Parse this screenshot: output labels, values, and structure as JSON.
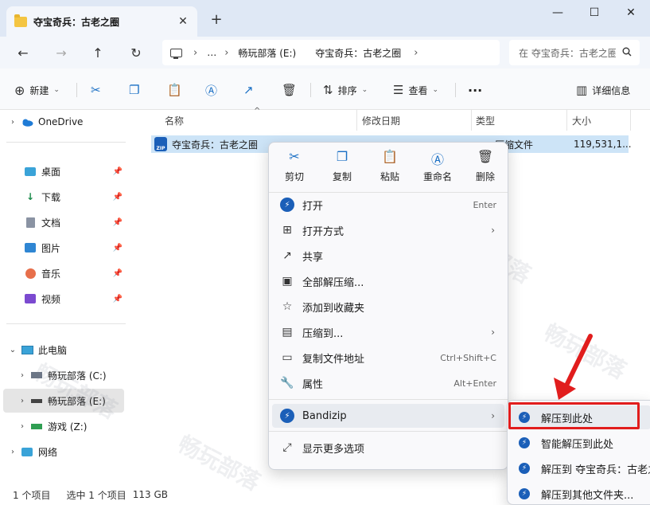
{
  "window": {
    "tab_title": "夺宝奇兵：古老之圈",
    "tab_close": "✕",
    "new_tab": "+",
    "minimize": "—",
    "maximize": "☐",
    "close": "✕"
  },
  "nav": {
    "back": "←",
    "forward": "→",
    "up": "↑",
    "refresh": "↻"
  },
  "address": {
    "crumbs": [
      "…",
      "畅玩部落 (E:)",
      "夺宝奇兵：古老之圈"
    ],
    "separator": "›",
    "search_placeholder": "在 夺宝奇兵：古老之圈 中搜索"
  },
  "commandbar": {
    "new_label": "新建",
    "sort_label": "排序",
    "view_label": "查看",
    "more_label": "···",
    "details_label": "详细信息"
  },
  "sidebar": {
    "onedrive": "OneDrive",
    "quick": [
      {
        "label": "桌面",
        "icon": "desktop-icon"
      },
      {
        "label": "下载",
        "icon": "download-icon"
      },
      {
        "label": "文档",
        "icon": "document-icon"
      },
      {
        "label": "图片",
        "icon": "picture-icon"
      },
      {
        "label": "音乐",
        "icon": "music-icon"
      },
      {
        "label": "视频",
        "icon": "video-icon"
      }
    ],
    "this_pc": "此电脑",
    "drives": [
      {
        "label": "畅玩部落 (C:)"
      },
      {
        "label": "畅玩部落 (E:)"
      },
      {
        "label": "游戏 (Z:)"
      }
    ],
    "network": "网络"
  },
  "filelist": {
    "columns": [
      "名称",
      "修改日期",
      "类型",
      "大小"
    ],
    "sort_indicator": "^",
    "rows": [
      {
        "name": "夺宝奇兵：古老之圈",
        "type": "压缩文件",
        "size": "119,531,1..."
      }
    ]
  },
  "status": {
    "count": "1 个项目",
    "selected": "选中 1 个项目",
    "size": "113 GB"
  },
  "context_menu": {
    "quick": [
      {
        "label": "剪切",
        "icon": "cut-icon"
      },
      {
        "label": "复制",
        "icon": "copy-icon"
      },
      {
        "label": "粘贴",
        "icon": "paste-icon"
      },
      {
        "label": "重命名",
        "icon": "rename-icon"
      },
      {
        "label": "删除",
        "icon": "delete-icon"
      }
    ],
    "items": [
      {
        "label": "打开",
        "key": "Enter"
      },
      {
        "label": "打开方式",
        "key": ""
      },
      {
        "label": "共享",
        "key": ""
      },
      {
        "label": "全部解压缩...",
        "key": ""
      },
      {
        "label": "添加到收藏夹",
        "key": ""
      },
      {
        "label": "压缩到...",
        "key": ""
      },
      {
        "label": "复制文件地址",
        "key": "Ctrl+Shift+C"
      },
      {
        "label": "属性",
        "key": "Alt+Enter"
      }
    ],
    "bandizip": "Bandizip",
    "more_options": "显示更多选项",
    "arrow": "›"
  },
  "submenu": {
    "items": [
      {
        "label": "解压到此处"
      },
      {
        "label": "智能解压到此处"
      },
      {
        "label": "解压到 夺宝奇兵：古老之圈\\"
      },
      {
        "label": "解压到其他文件夹..."
      }
    ]
  },
  "colors": {
    "accent": "#1a6fc4",
    "highlight_box": "#e11d1d",
    "selection": "#cde4f7"
  }
}
